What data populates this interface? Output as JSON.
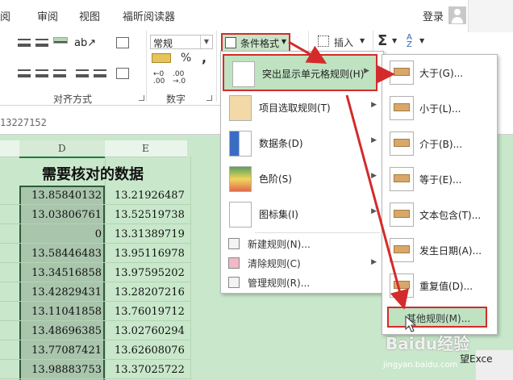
{
  "tabs": [
    "审阅",
    "视图",
    "福昕阅读器"
  ],
  "account": {
    "login_label": "登录"
  },
  "ribbon": {
    "number_format_value": "常规",
    "conditional_format_label": "条件格式",
    "insert_label": "插入",
    "percent_symbol": "%",
    "comma_symbol": ",",
    "sum_symbol": "Σ",
    "alignment_group_label": "对齐方式",
    "number_group_label": "数字"
  },
  "formula_bar": {
    "partial_value": "13227152"
  },
  "sheet": {
    "columns": [
      "D",
      "E"
    ],
    "title": "需要核对的数据",
    "rows": [
      [
        "13.85840132",
        "13.21926487"
      ],
      [
        "13.03806761",
        "13.52519738"
      ],
      [
        "0",
        "13.31389719"
      ],
      [
        "13.58446483",
        "13.95116978"
      ],
      [
        "13.34516858",
        "13.97595202"
      ],
      [
        "13.42829431",
        "13.28207216"
      ],
      [
        "13.11041858",
        "13.76019712"
      ],
      [
        "13.48696385",
        "13.02760294"
      ],
      [
        "13.77087421",
        "13.62608076"
      ],
      [
        "13.98883753",
        "13.37025722"
      ]
    ]
  },
  "conditional_menu": {
    "items": [
      {
        "label": "突出显示单元格规则(H)",
        "icon": "highlight-cells-icon",
        "submenu": true
      },
      {
        "label": "项目选取规则(T)",
        "icon": "top-bottom-icon",
        "submenu": true
      },
      {
        "label": "数据条(D)",
        "icon": "data-bars-icon",
        "submenu": true
      },
      {
        "label": "色阶(S)",
        "icon": "color-scales-icon",
        "submenu": true
      },
      {
        "label": "图标集(I)",
        "icon": "icon-sets-icon",
        "submenu": true
      }
    ],
    "small_items": [
      {
        "label": "新建规则(N)...",
        "submenu": false
      },
      {
        "label": "清除规则(C)",
        "submenu": true
      },
      {
        "label": "管理规则(R)...",
        "submenu": false
      }
    ]
  },
  "highlight_submenu": {
    "items": [
      "大于(G)...",
      "小于(L)...",
      "介于(B)...",
      "等于(E)...",
      "文本包含(T)...",
      "发生日期(A)...",
      "重复值(D)..."
    ],
    "more_rules": "其他规则(M)..."
  },
  "colors": {
    "accent_red": "#d32b2b",
    "sheet_green": "#c9e8cb",
    "selected_green": "#a9c5ac"
  },
  "watermark": {
    "main": "Baidu经验",
    "sub": "jingyan.baidu.com"
  },
  "background_text": {
    "excel_fragment": "望Exce"
  }
}
